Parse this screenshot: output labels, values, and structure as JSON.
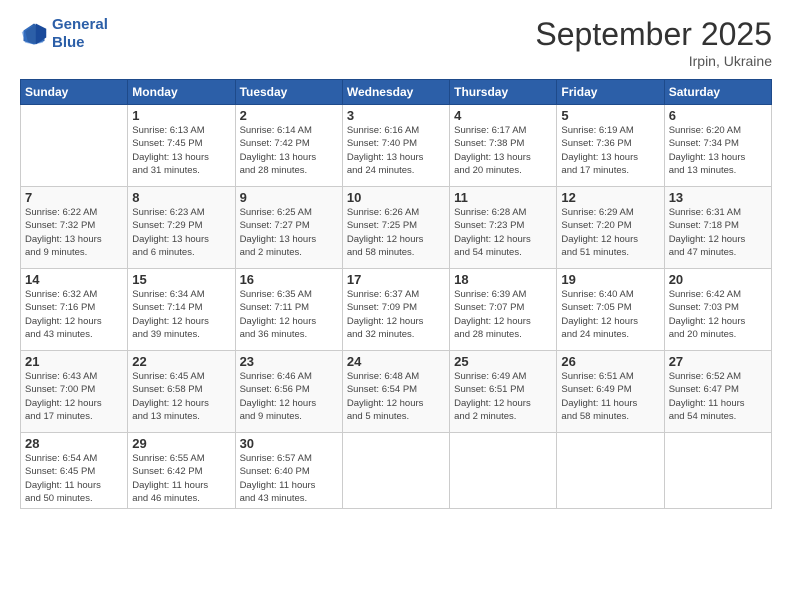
{
  "logo": {
    "line1": "General",
    "line2": "Blue"
  },
  "header": {
    "month": "September 2025",
    "location": "Irpin, Ukraine"
  },
  "weekdays": [
    "Sunday",
    "Monday",
    "Tuesday",
    "Wednesday",
    "Thursday",
    "Friday",
    "Saturday"
  ],
  "weeks": [
    [
      {
        "day": "",
        "info": ""
      },
      {
        "day": "1",
        "info": "Sunrise: 6:13 AM\nSunset: 7:45 PM\nDaylight: 13 hours\nand 31 minutes."
      },
      {
        "day": "2",
        "info": "Sunrise: 6:14 AM\nSunset: 7:42 PM\nDaylight: 13 hours\nand 28 minutes."
      },
      {
        "day": "3",
        "info": "Sunrise: 6:16 AM\nSunset: 7:40 PM\nDaylight: 13 hours\nand 24 minutes."
      },
      {
        "day": "4",
        "info": "Sunrise: 6:17 AM\nSunset: 7:38 PM\nDaylight: 13 hours\nand 20 minutes."
      },
      {
        "day": "5",
        "info": "Sunrise: 6:19 AM\nSunset: 7:36 PM\nDaylight: 13 hours\nand 17 minutes."
      },
      {
        "day": "6",
        "info": "Sunrise: 6:20 AM\nSunset: 7:34 PM\nDaylight: 13 hours\nand 13 minutes."
      }
    ],
    [
      {
        "day": "7",
        "info": "Sunrise: 6:22 AM\nSunset: 7:32 PM\nDaylight: 13 hours\nand 9 minutes."
      },
      {
        "day": "8",
        "info": "Sunrise: 6:23 AM\nSunset: 7:29 PM\nDaylight: 13 hours\nand 6 minutes."
      },
      {
        "day": "9",
        "info": "Sunrise: 6:25 AM\nSunset: 7:27 PM\nDaylight: 13 hours\nand 2 minutes."
      },
      {
        "day": "10",
        "info": "Sunrise: 6:26 AM\nSunset: 7:25 PM\nDaylight: 12 hours\nand 58 minutes."
      },
      {
        "day": "11",
        "info": "Sunrise: 6:28 AM\nSunset: 7:23 PM\nDaylight: 12 hours\nand 54 minutes."
      },
      {
        "day": "12",
        "info": "Sunrise: 6:29 AM\nSunset: 7:20 PM\nDaylight: 12 hours\nand 51 minutes."
      },
      {
        "day": "13",
        "info": "Sunrise: 6:31 AM\nSunset: 7:18 PM\nDaylight: 12 hours\nand 47 minutes."
      }
    ],
    [
      {
        "day": "14",
        "info": "Sunrise: 6:32 AM\nSunset: 7:16 PM\nDaylight: 12 hours\nand 43 minutes."
      },
      {
        "day": "15",
        "info": "Sunrise: 6:34 AM\nSunset: 7:14 PM\nDaylight: 12 hours\nand 39 minutes."
      },
      {
        "day": "16",
        "info": "Sunrise: 6:35 AM\nSunset: 7:11 PM\nDaylight: 12 hours\nand 36 minutes."
      },
      {
        "day": "17",
        "info": "Sunrise: 6:37 AM\nSunset: 7:09 PM\nDaylight: 12 hours\nand 32 minutes."
      },
      {
        "day": "18",
        "info": "Sunrise: 6:39 AM\nSunset: 7:07 PM\nDaylight: 12 hours\nand 28 minutes."
      },
      {
        "day": "19",
        "info": "Sunrise: 6:40 AM\nSunset: 7:05 PM\nDaylight: 12 hours\nand 24 minutes."
      },
      {
        "day": "20",
        "info": "Sunrise: 6:42 AM\nSunset: 7:03 PM\nDaylight: 12 hours\nand 20 minutes."
      }
    ],
    [
      {
        "day": "21",
        "info": "Sunrise: 6:43 AM\nSunset: 7:00 PM\nDaylight: 12 hours\nand 17 minutes."
      },
      {
        "day": "22",
        "info": "Sunrise: 6:45 AM\nSunset: 6:58 PM\nDaylight: 12 hours\nand 13 minutes."
      },
      {
        "day": "23",
        "info": "Sunrise: 6:46 AM\nSunset: 6:56 PM\nDaylight: 12 hours\nand 9 minutes."
      },
      {
        "day": "24",
        "info": "Sunrise: 6:48 AM\nSunset: 6:54 PM\nDaylight: 12 hours\nand 5 minutes."
      },
      {
        "day": "25",
        "info": "Sunrise: 6:49 AM\nSunset: 6:51 PM\nDaylight: 12 hours\nand 2 minutes."
      },
      {
        "day": "26",
        "info": "Sunrise: 6:51 AM\nSunset: 6:49 PM\nDaylight: 11 hours\nand 58 minutes."
      },
      {
        "day": "27",
        "info": "Sunrise: 6:52 AM\nSunset: 6:47 PM\nDaylight: 11 hours\nand 54 minutes."
      }
    ],
    [
      {
        "day": "28",
        "info": "Sunrise: 6:54 AM\nSunset: 6:45 PM\nDaylight: 11 hours\nand 50 minutes."
      },
      {
        "day": "29",
        "info": "Sunrise: 6:55 AM\nSunset: 6:42 PM\nDaylight: 11 hours\nand 46 minutes."
      },
      {
        "day": "30",
        "info": "Sunrise: 6:57 AM\nSunset: 6:40 PM\nDaylight: 11 hours\nand 43 minutes."
      },
      {
        "day": "",
        "info": ""
      },
      {
        "day": "",
        "info": ""
      },
      {
        "day": "",
        "info": ""
      },
      {
        "day": "",
        "info": ""
      }
    ]
  ]
}
